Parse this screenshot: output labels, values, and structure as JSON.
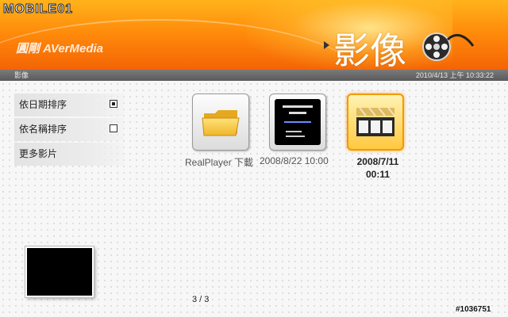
{
  "watermark_logo": "MOBILE01",
  "header": {
    "brand": "圓剛 AVerMedia",
    "page_title": "影像"
  },
  "status": {
    "breadcrumb": "影像",
    "datetime": "2010/4/13 上午 10:33:22"
  },
  "sidebar": {
    "items": [
      {
        "label": "依日期排序",
        "checked": true
      },
      {
        "label": "依名稱排序",
        "checked": false
      },
      {
        "label": "更多影片"
      }
    ]
  },
  "grid": {
    "items": [
      {
        "label": "RealPlayer 下載",
        "icon": "folder-icon"
      },
      {
        "label": "2008/8/22 10:00",
        "icon": "video-thumbnail"
      },
      {
        "label": "2008/7/11 00:11",
        "icon": "film-strip-icon",
        "selected": true
      }
    ]
  },
  "pager": "3 / 3",
  "watermark_id": "#1036751",
  "colors": {
    "header_orange": "#ff8a0a",
    "selection_orange": "#f19a00"
  }
}
